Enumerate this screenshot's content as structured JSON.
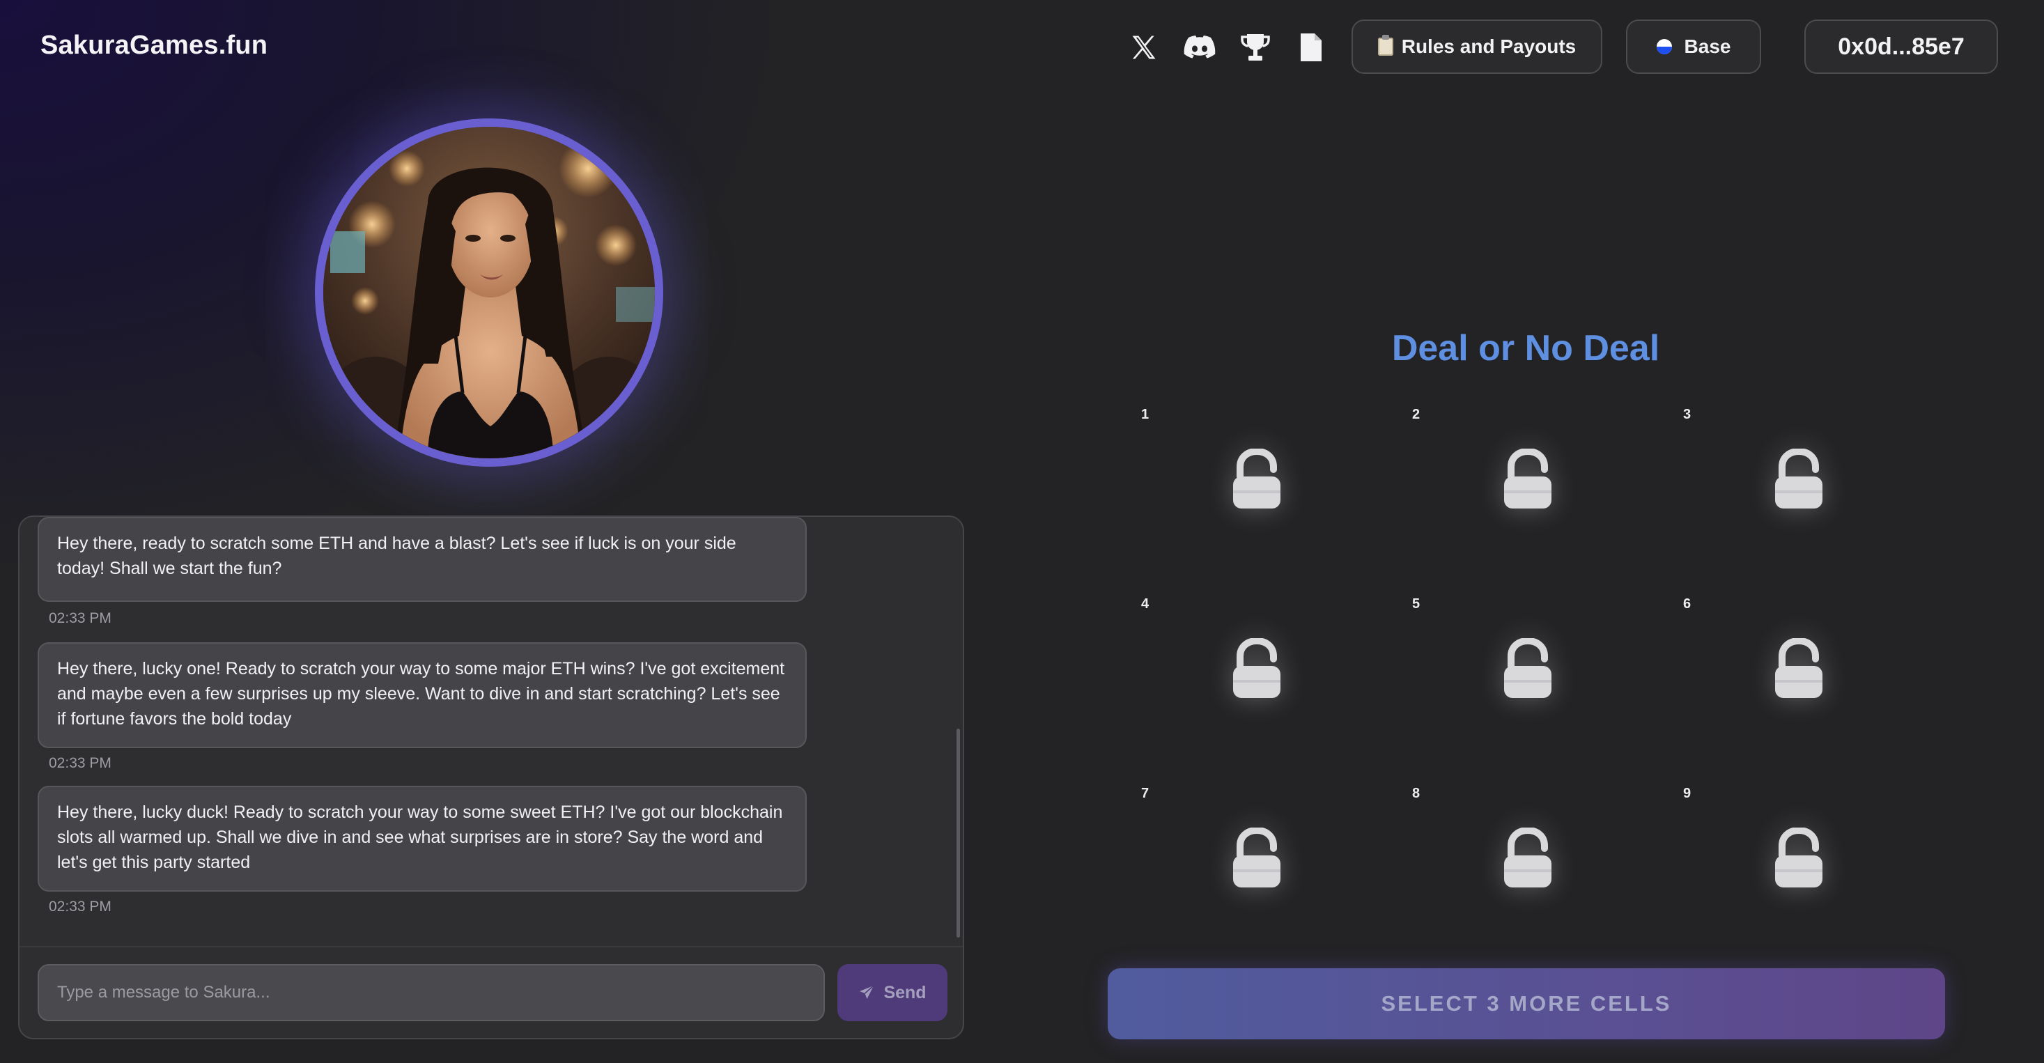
{
  "header": {
    "brand": "SakuraGames.fun",
    "icons": [
      "x-icon",
      "discord-icon",
      "trophy-icon",
      "document-icon"
    ],
    "rules_label": "Rules and Payouts",
    "network_label": "Base",
    "wallet_label": "0x0d...85e7"
  },
  "chat": {
    "messages": [
      {
        "text": "Hey there, ready to scratch some ETH and have a blast? Let's see if luck is on your side today! Shall we start the fun?",
        "time": "02:33 PM"
      },
      {
        "text": "Hey there, lucky one! Ready to scratch your way to some major ETH wins? I've got excitement and maybe even a few surprises up my sleeve. Want to dive in and start scratching? Let's see if fortune favors the bold today",
        "time": "02:33 PM"
      },
      {
        "text": "Hey there, lucky duck! Ready to scratch your way to some sweet ETH? I've got our blockchain slots all warmed up. Shall we dive in and see what surprises are in store? Say the word and let's get this party started",
        "time": "02:33 PM"
      }
    ],
    "input_placeholder": "Type a message to Sakura...",
    "send_label": "Send"
  },
  "game": {
    "title": "Deal or No Deal",
    "cells": [
      {
        "number": "1",
        "state": "unlocked"
      },
      {
        "number": "2",
        "state": "unlocked"
      },
      {
        "number": "3",
        "state": "unlocked"
      },
      {
        "number": "4",
        "state": "unlocked"
      },
      {
        "number": "5",
        "state": "unlocked"
      },
      {
        "number": "6",
        "state": "unlocked"
      },
      {
        "number": "7",
        "state": "unlocked"
      },
      {
        "number": "8",
        "state": "unlocked"
      },
      {
        "number": "9",
        "state": "unlocked"
      }
    ],
    "action_label": "SELECT 3 MORE CELLS"
  },
  "colors": {
    "accent": "#5f8fe0",
    "avatar_ring": "#6a5fd0",
    "send_button": "#4f3a7a"
  }
}
